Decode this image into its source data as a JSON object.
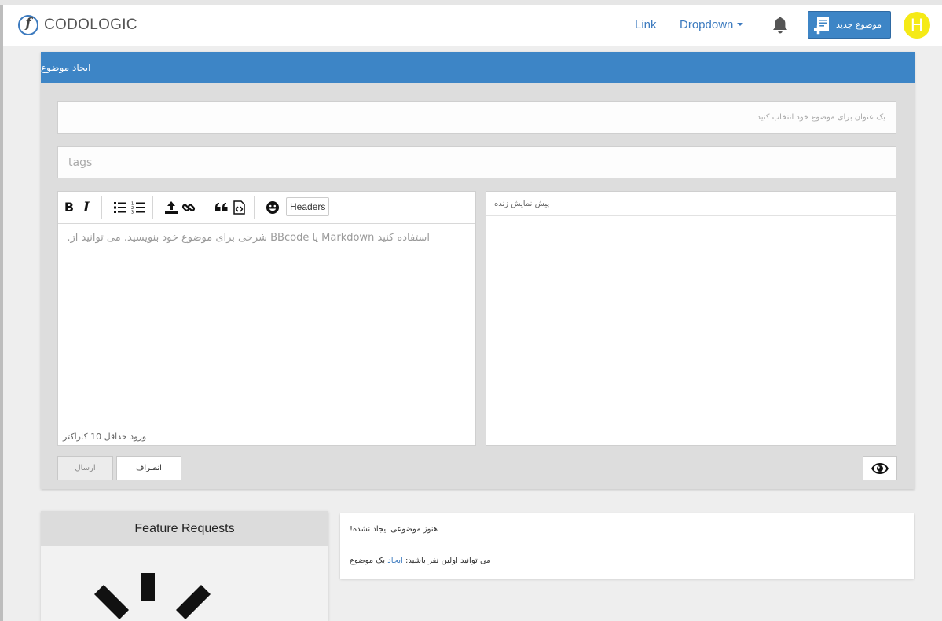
{
  "navbar": {
    "brand_letter": "f",
    "brand_text": "CODOLOGIC",
    "link_label": "Link",
    "dropdown_label": "Dropdown",
    "new_topic_label": "موضوع جدید",
    "avatar_letter": "H"
  },
  "panel": {
    "title": "ایجاد موضوع",
    "title_placeholder": "یک عنوان برای موضوع خود انتخاب کنید",
    "tags_placeholder": "tags",
    "editor": {
      "headers_label": "Headers",
      "placeholder": "استفاده کنید  Markdown یا BBcode شرحی برای موضوع خود بنویسید. می توانید از.",
      "min_chars": "ورود حداقل 10 کاراکتر"
    },
    "preview_title": "پیش نمایش زنده",
    "send_label": "ارسال",
    "cancel_label": "انصراف"
  },
  "feature": {
    "title": "Feature Requests"
  },
  "notice": {
    "line1": "!هنوز موضوعی ایجاد نشده",
    "line2_prefix": "می توانید اولین نفر باشید: ",
    "line2_link": "ایجاد",
    "line2_suffix": " یک موضوع"
  },
  "colors": {
    "accent": "#3d85c6",
    "link": "#3d7bbf",
    "avatar": "#f5ea16"
  }
}
